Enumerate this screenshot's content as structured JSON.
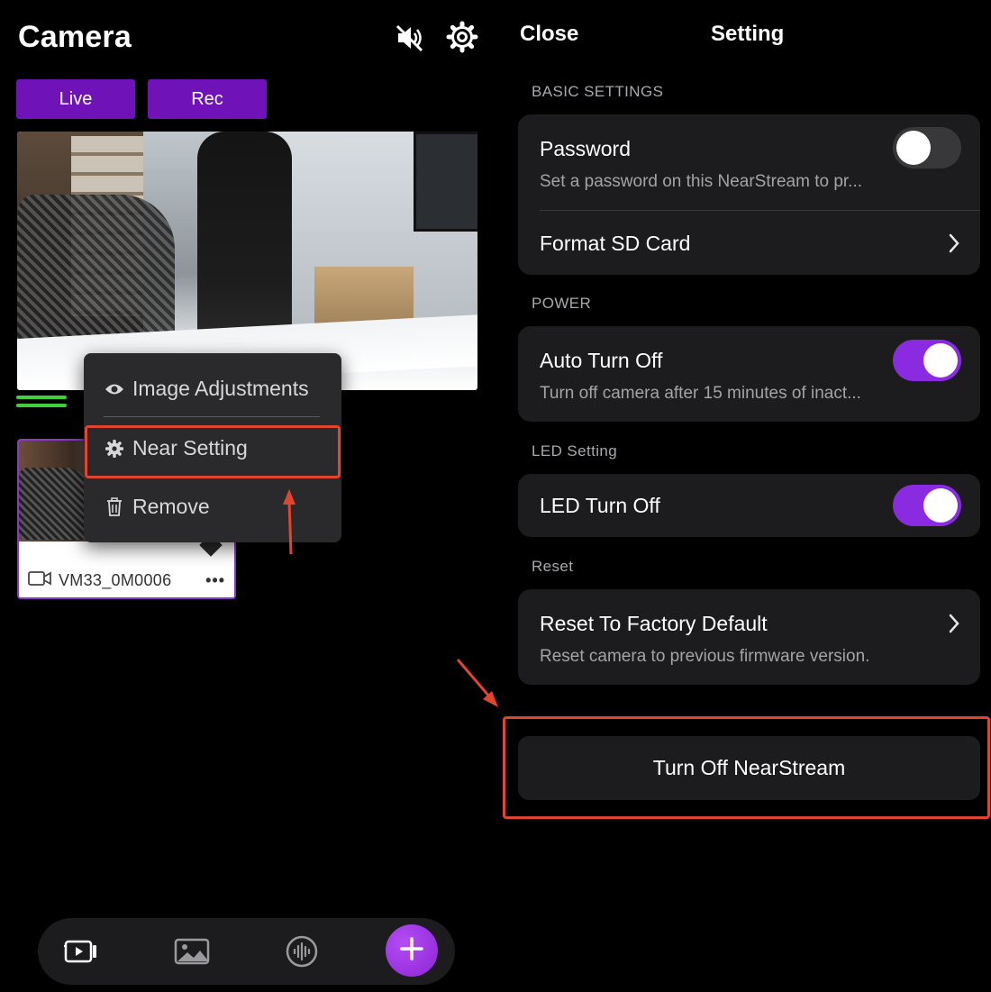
{
  "camera": {
    "title": "Camera",
    "tabs": [
      {
        "label": "Live"
      },
      {
        "label": "Rec"
      }
    ],
    "thumbnail": {
      "name": "VM33_0M0006",
      "more": "•••"
    },
    "context_menu": {
      "items": [
        {
          "label": "Image Adjustments",
          "icon": "eye-icon"
        },
        {
          "label": "Near Setting",
          "icon": "gear-icon"
        },
        {
          "label": "Remove",
          "icon": "trash-icon"
        }
      ]
    },
    "dock": {
      "icons": [
        "video-library-icon",
        "gallery-icon",
        "audio-icon",
        "add-icon"
      ],
      "fab_symbol": "+"
    }
  },
  "settings": {
    "close_label": "Close",
    "title": "Setting",
    "sections": [
      {
        "header": "BASIC SETTINGS",
        "rows": [
          {
            "title": "Password",
            "subtitle": "Set a password on this NearStream to pr...",
            "control": "toggle",
            "on": false
          },
          {
            "title": "Format SD Card",
            "control": "chevron"
          }
        ]
      },
      {
        "header": "POWER",
        "rows": [
          {
            "title": "Auto Turn Off",
            "subtitle": "Turn off camera after 15 minutes of inact...",
            "control": "toggle",
            "on": true
          }
        ]
      },
      {
        "header": "LED Setting",
        "rows": [
          {
            "title": "LED Turn Off",
            "control": "toggle",
            "on": true
          }
        ]
      },
      {
        "header": "Reset",
        "rows": [
          {
            "title": "Reset To Factory Default",
            "subtitle": "Reset camera to previous firmware version.",
            "control": "chevron"
          }
        ]
      }
    ],
    "turn_off_label": "Turn Off NearStream"
  },
  "colors": {
    "accent_purple": "#8a2be2",
    "tab_purple": "#6f12b8",
    "highlight_red": "#e2452f",
    "signal_green": "#3fd13a"
  }
}
